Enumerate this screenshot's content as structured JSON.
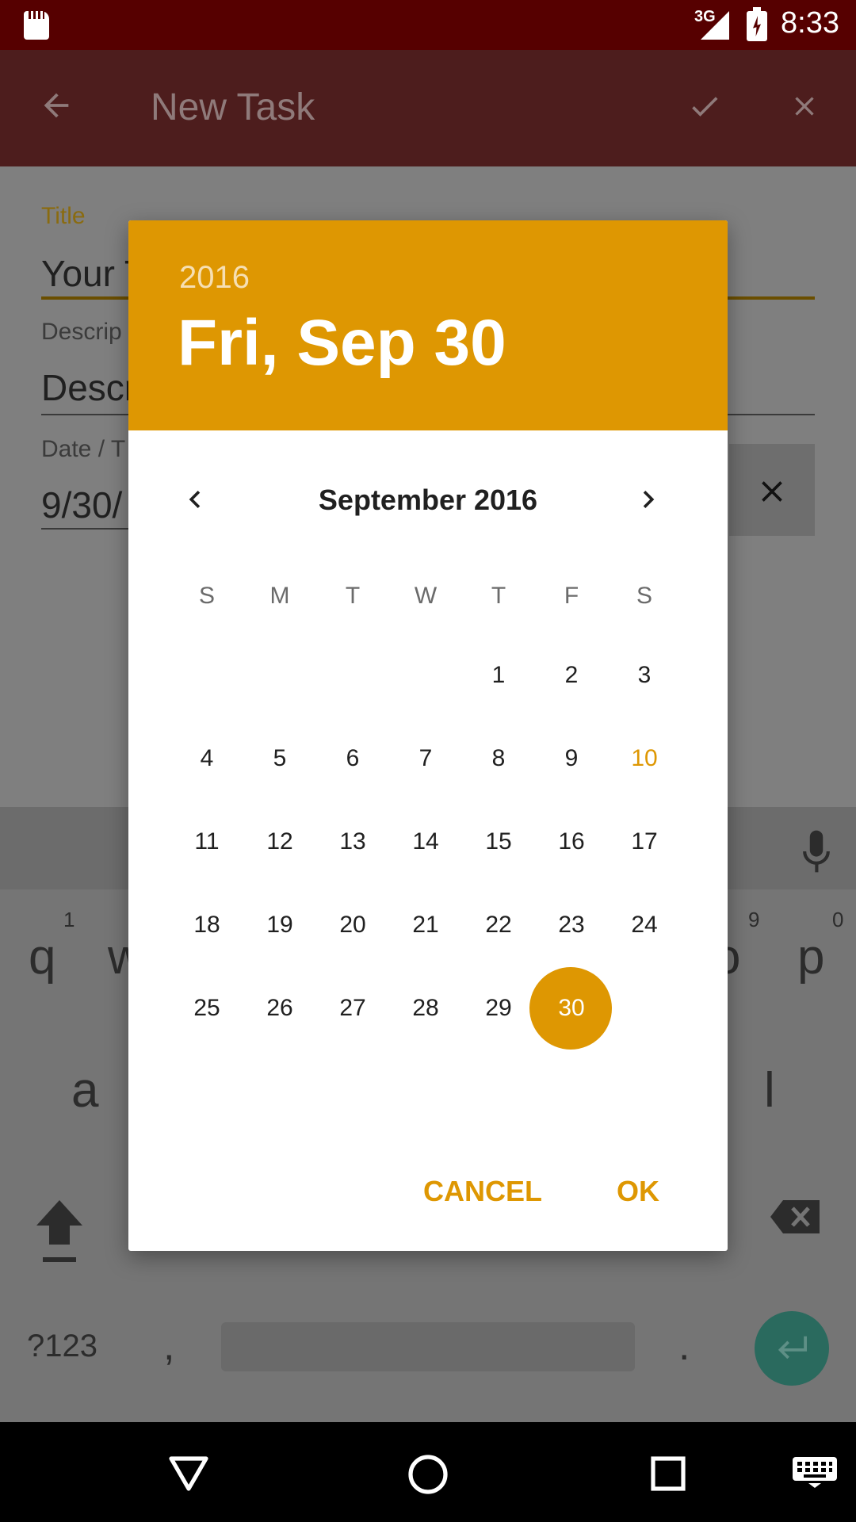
{
  "status_bar": {
    "network": "3G",
    "time": "8:33"
  },
  "app_bar": {
    "title": "New Task",
    "back_icon": "arrow-back-icon",
    "confirm_icon": "check-icon",
    "close_icon": "close-icon"
  },
  "form": {
    "title_label": "Title",
    "title_value": "Your T",
    "description_label": "Descrip",
    "description_value": "Descr",
    "date_label": "Date / T",
    "date_value": "9/30/",
    "clear_icon": "close-icon"
  },
  "keyboard": {
    "row1": [
      "q",
      "w",
      "o",
      "p"
    ],
    "row1_hints": [
      "1",
      "9",
      "0"
    ],
    "row2": [
      "a",
      "l"
    ],
    "symbols_label": "?123",
    "comma": ",",
    "period": ".",
    "mic_icon": "mic-icon",
    "shift_icon": "shift-icon",
    "backspace_icon": "backspace-icon",
    "enter_icon": "enter-icon"
  },
  "date_picker": {
    "year": "2016",
    "selected_date": "Fri, Sep 30",
    "month_label": "September 2016",
    "weekdays": [
      "S",
      "M",
      "T",
      "W",
      "T",
      "F",
      "S"
    ],
    "weeks": [
      [
        "",
        "",
        "",
        "",
        "1",
        "2",
        "3"
      ],
      [
        "4",
        "5",
        "6",
        "7",
        "8",
        "9",
        "10"
      ],
      [
        "11",
        "12",
        "13",
        "14",
        "15",
        "16",
        "17"
      ],
      [
        "18",
        "19",
        "20",
        "21",
        "22",
        "23",
        "24"
      ],
      [
        "25",
        "26",
        "27",
        "28",
        "29",
        "30",
        ""
      ]
    ],
    "today_day": "10",
    "selected_day": "30",
    "cancel_label": "CANCEL",
    "ok_label": "OK",
    "accent_color": "#DE9702"
  },
  "nav_bar": {
    "back_icon": "nav-back-icon",
    "home_icon": "nav-home-icon",
    "recents_icon": "nav-recents-icon",
    "keyboard_icon": "keyboard-icon"
  }
}
